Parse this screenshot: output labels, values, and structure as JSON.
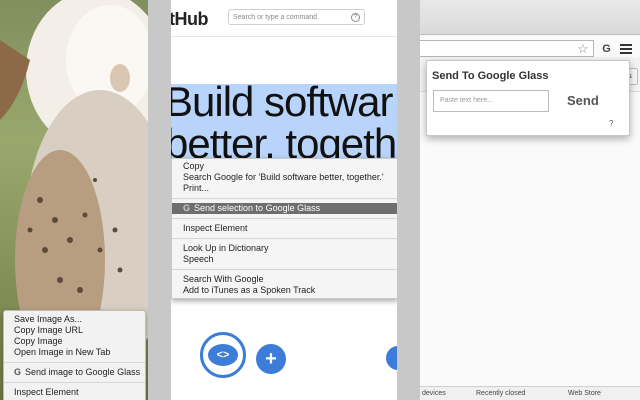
{
  "left_panel": {
    "context_menu": {
      "items": [
        "Save Image As...",
        "Copy Image URL",
        "Copy Image",
        "Open Image in New Tab"
      ],
      "extension_badge": "G",
      "extension_item": "Send image to Google Glass",
      "inspect": "Inspect Element"
    }
  },
  "github": {
    "logo_text": "tHub",
    "search_placeholder": "Search or type a command",
    "help_glyph": "?",
    "hero_line1": "Build softwar",
    "hero_line2": "better, togeth",
    "context_menu": {
      "group1": [
        "Copy",
        "Search Google for 'Build software better, together.'",
        "Print..."
      ],
      "extension_badge": "G",
      "extension_item": "Send selection to Google Glass",
      "inspect": "Inspect Element",
      "group3": [
        "Look Up in Dictionary",
        "Speech"
      ],
      "group4": [
        "Search With Google",
        "Add to iTunes as a Spoken Track"
      ]
    },
    "icon_code_glyph": "<>",
    "icon_plus_glyph": "+"
  },
  "chrome": {
    "star_glyph": "☆",
    "extension_glyph": "G",
    "popup": {
      "title": "Send To Google Glass",
      "input_placeholder": "Paste text here...",
      "send_label": "Send",
      "help_label": "?"
    },
    "side_button_text": "s",
    "side_text": "P",
    "bottom_bar": {
      "other_devices": "devices",
      "recently_closed": "Recently closed",
      "web_store": "Web Store"
    }
  },
  "colors": {
    "selection_highlight": "#b9d4fa",
    "menu_highlight": "#6e6e6e",
    "github_blue": "#3b7dd8"
  }
}
